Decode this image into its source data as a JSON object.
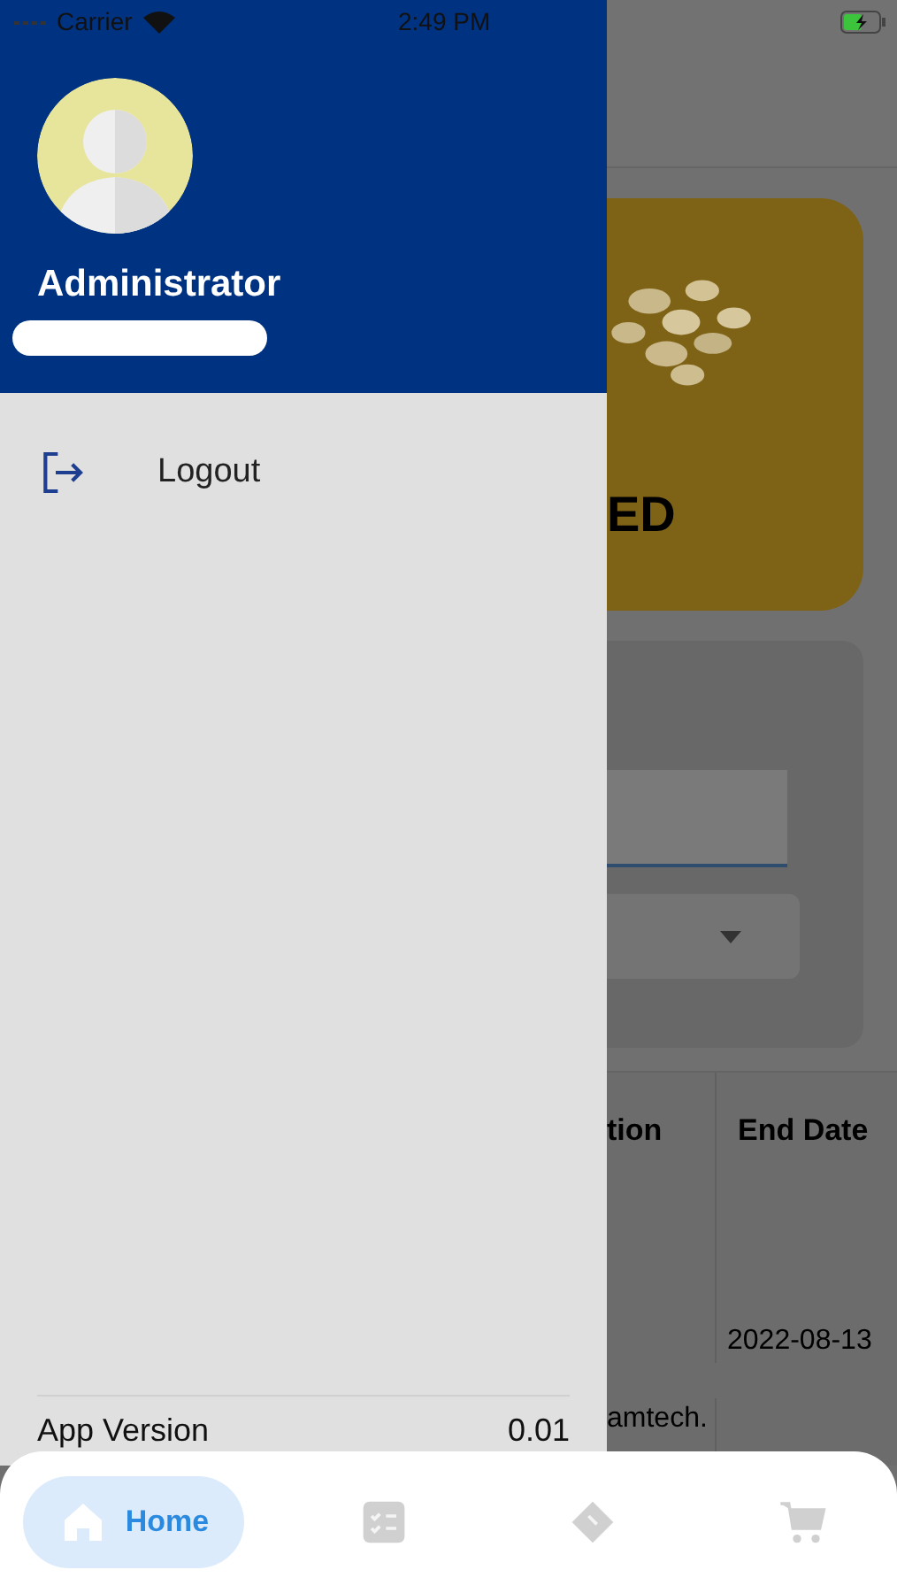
{
  "status_bar": {
    "carrier": "Carrier",
    "time": "2:49 PM"
  },
  "drawer": {
    "user_name": "Administrator",
    "menu": [
      {
        "label": "Logout",
        "kind": "logout"
      }
    ],
    "footer": {
      "label": "App Version",
      "value": "0.01"
    }
  },
  "background": {
    "banner_text": "ED",
    "table": {
      "columns": [
        "tion",
        "End Date"
      ],
      "rows": [
        {
          "end_date": "2022-08-13"
        },
        {
          "column_1": "amtech."
        }
      ]
    }
  },
  "nav": [
    {
      "label": "Home",
      "selected": true,
      "kind": "home"
    },
    {
      "selected": false,
      "kind": "checklist"
    },
    {
      "selected": false,
      "kind": "ticket"
    },
    {
      "selected": false,
      "kind": "cart"
    }
  ]
}
